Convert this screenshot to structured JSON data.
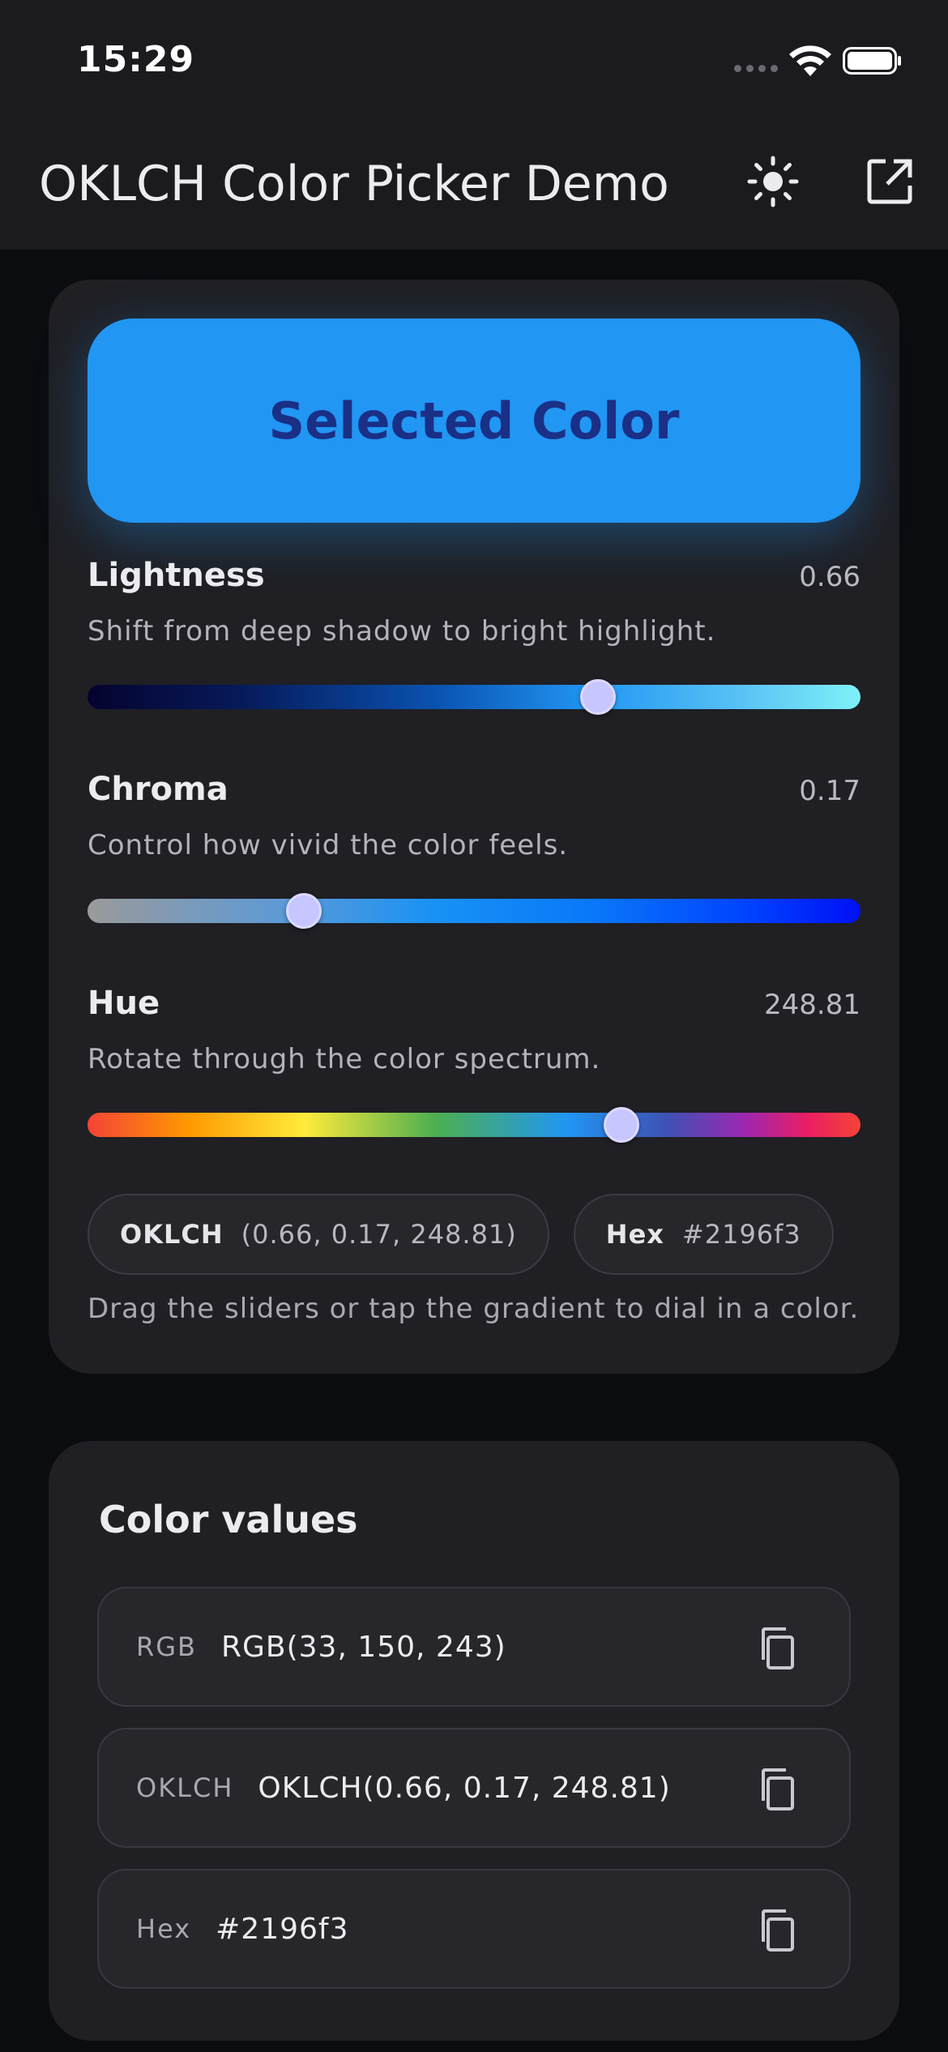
{
  "status": {
    "time": "15:29"
  },
  "appbar": {
    "title": "OKLCH Color Picker Demo",
    "theme_icon": "sun-icon",
    "open_icon": "open-external-icon"
  },
  "picker": {
    "swatch_label": "Selected Color",
    "swatch_color": "#2196f3",
    "sliders": {
      "lightness": {
        "title": "Lightness",
        "value": "0.66",
        "fraction": 0.66,
        "description": "Shift from deep shadow to bright highlight."
      },
      "chroma": {
        "title": "Chroma",
        "value": "0.17",
        "fraction": 0.28,
        "description": "Control how vivid the color feels."
      },
      "hue": {
        "title": "Hue",
        "value": "248.81",
        "fraction": 0.691,
        "description": "Rotate through the color spectrum."
      }
    },
    "chips": [
      {
        "key": "OKLCH",
        "value": "(0.66, 0.17, 248.81)"
      },
      {
        "key": "Hex",
        "value": "#2196f3"
      }
    ],
    "helper": "Drag the sliders or tap the gradient to dial in a color."
  },
  "values": {
    "title": "Color values",
    "rows": [
      {
        "key": "RGB",
        "value": "RGB(33, 150, 243)"
      },
      {
        "key": "OKLCH",
        "value": "OKLCH(0.66, 0.17, 248.81)"
      },
      {
        "key": "Hex",
        "value": "#2196f3"
      }
    ]
  }
}
